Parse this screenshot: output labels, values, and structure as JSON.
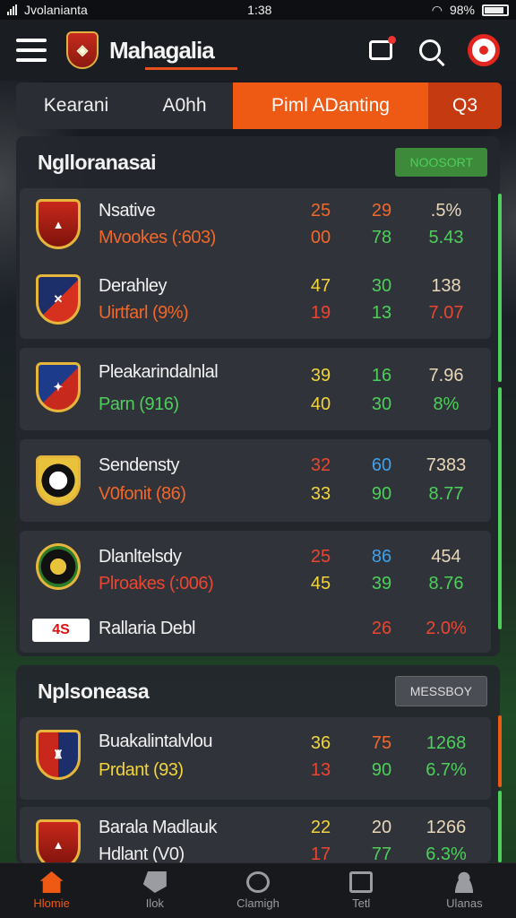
{
  "status_bar": {
    "left_text": "Jvolanianta",
    "time": "1:38",
    "battery": "98%"
  },
  "app_bar": {
    "title": "Mahagalia",
    "logo_icon": "club-crest-icon"
  },
  "tabs": [
    {
      "label": "Kearani"
    },
    {
      "label": "A0hh"
    },
    {
      "label": "Piml ADanting",
      "active": true
    },
    {
      "label": "Q3"
    }
  ],
  "sections": [
    {
      "title": "Nglloranasai",
      "button": "NOOSORT",
      "rows": [
        {
          "teams": [
            {
              "name": "Nsative",
              "sub": "Mvookes (:603)",
              "sub_color": "orange",
              "values": [
                "25",
                "29",
                ".5%"
              ],
              "colors": [
                "orange",
                "orange",
                "cream"
              ]
            },
            {
              "name": "Derahley",
              "sub": "Uirtfarl (9%)",
              "sub_color": "orange",
              "values": [
                "47",
                "30",
                "138"
              ],
              "colors": [
                "yellow",
                "green",
                "cream"
              ]
            }
          ]
        },
        {
          "teams": [
            {
              "name": "Pleakarindalnlal",
              "sub": "Parn (916)",
              "sub_color": "green",
              "values": [
                "39",
                "16",
                "7.96"
              ],
              "colors": [
                "yellow",
                "green",
                "cream"
              ]
            },
            {
              "name": "",
              "sub": "",
              "values": [
                "40",
                "30",
                "8%"
              ],
              "colors": [
                "yellow",
                "green",
                "green"
              ]
            }
          ]
        },
        {
          "teams": [
            {
              "name": "Sendensty",
              "sub": "V0fonit (86)",
              "sub_color": "orange",
              "values": [
                "32",
                "60",
                "7383"
              ],
              "colors": [
                "red",
                "blue",
                "cream"
              ]
            },
            {
              "name": "",
              "sub": "",
              "values": [
                "33",
                "90",
                "8.77"
              ],
              "colors": [
                "yellow",
                "green",
                "green"
              ]
            }
          ]
        },
        {
          "teams": [
            {
              "name": "Dlanltelsdy",
              "sub": "Plroakes (:006)",
              "sub_color": "red",
              "values": [
                "25",
                "86",
                "454"
              ],
              "colors": [
                "red",
                "blue",
                "cream"
              ]
            },
            {
              "name": "",
              "sub": "",
              "values": [
                "45",
                "39",
                "8.76"
              ],
              "colors": [
                "yellow",
                "green",
                "green"
              ]
            }
          ],
          "footer": {
            "badge": "4S",
            "name": "Rallaria Debl",
            "values": [
              "26",
              "2.0%"
            ]
          }
        }
      ]
    },
    {
      "title": "Nplsoneasa",
      "button": "MESSBOY",
      "rows": [
        {
          "teams": [
            {
              "name": "Buakalintalvlou",
              "sub": "Prdant (93)",
              "sub_color": "yellow",
              "values": [
                "36",
                "75",
                "1268"
              ],
              "colors": [
                "yellow",
                "orange",
                "green"
              ]
            },
            {
              "name": "",
              "sub": "",
              "values": [
                "13",
                "90",
                "6.7%"
              ],
              "colors": [
                "red",
                "green",
                "green"
              ]
            }
          ]
        },
        {
          "teams": [
            {
              "name": "Barala Madlauk",
              "sub": "Hdlant (V0)",
              "sub_color": "white",
              "values": [
                "22",
                "20",
                "1266"
              ],
              "colors": [
                "yellow",
                "cream",
                "cream"
              ]
            },
            {
              "name": "",
              "sub": "",
              "values": [
                "17",
                "77",
                "6.3%"
              ],
              "colors": [
                "red",
                "green",
                "green"
              ]
            }
          ]
        }
      ]
    }
  ],
  "bottom_nav": [
    {
      "label": "Hlomie",
      "icon": "home-icon",
      "active": true
    },
    {
      "label": "Ilok",
      "icon": "tag-icon"
    },
    {
      "label": "Clamigh",
      "icon": "circle-icon"
    },
    {
      "label": "Tetl",
      "icon": "note-icon"
    },
    {
      "label": "Ulanas",
      "icon": "user-icon"
    }
  ],
  "colors": {
    "accent": "#ee5a14",
    "green": "#4cd05a",
    "yellow": "#f2d53a",
    "red": "#ec4630",
    "blue": "#3fa3ec"
  }
}
